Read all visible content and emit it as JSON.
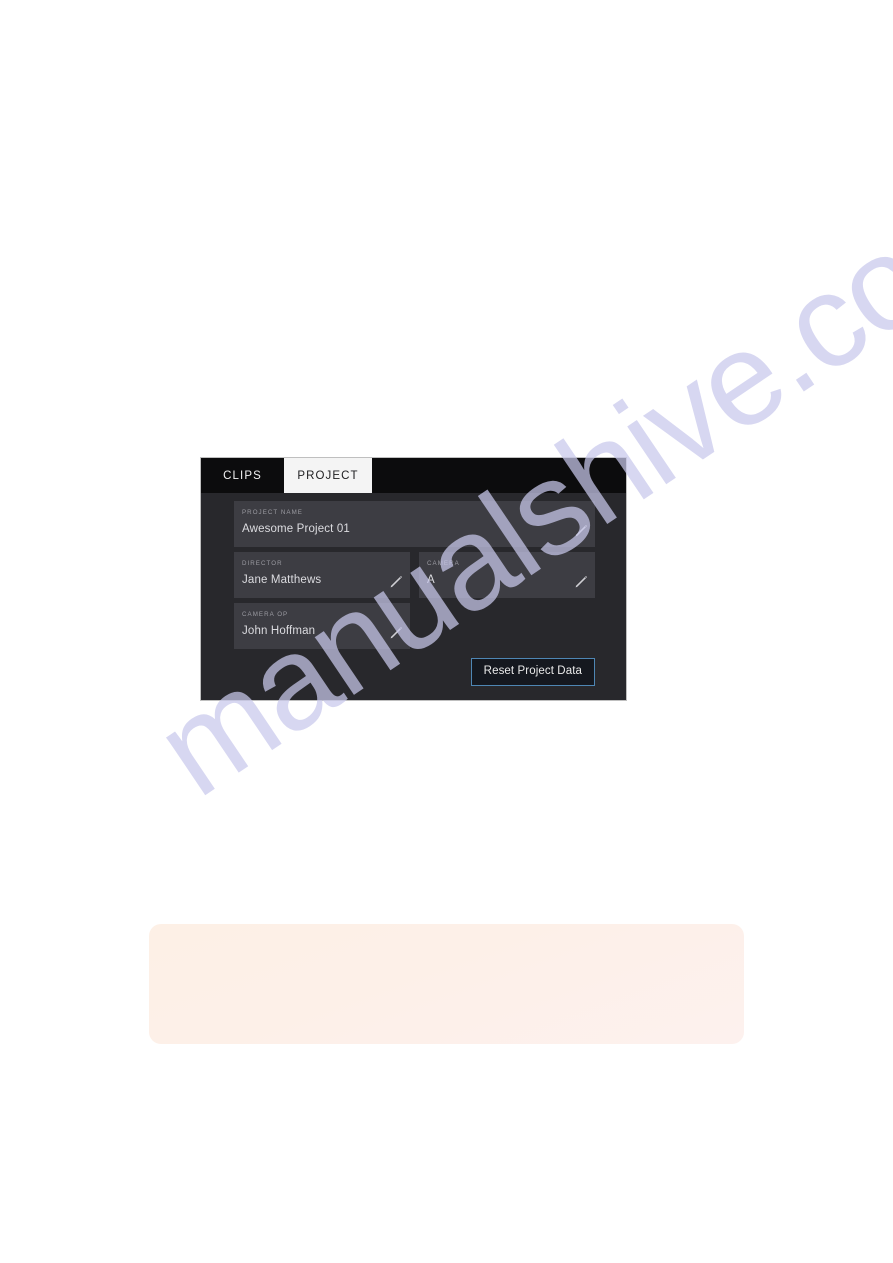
{
  "watermark": {
    "text": "manualshive.com",
    "color": "#c9c9ec"
  },
  "panel": {
    "background": "#28282c",
    "tabs": [
      {
        "label": "CLIPS",
        "active": false
      },
      {
        "label": "PROJECT",
        "active": true
      }
    ],
    "fields": [
      {
        "label": "PROJECT NAME",
        "value": "Awesome Project 01",
        "icon": "pencil-edit-icon",
        "width": "full"
      },
      {
        "label": "DIRECTOR",
        "value": "Jane Matthews",
        "icon": "pencil-edit-icon",
        "width": "half"
      },
      {
        "label": "CAMERA",
        "value": "A",
        "icon": "pencil-edit-icon",
        "width": "half"
      },
      {
        "label": "CAMERA OP",
        "value": "John Hoffman",
        "icon": "pencil-edit-icon",
        "width": "half"
      }
    ],
    "reset_button": {
      "label": "Reset Project Data",
      "border_color": "#4e86b4",
      "background": "#15181f"
    }
  },
  "peach_block": {
    "color": "#fdf0e8",
    "text": ""
  }
}
